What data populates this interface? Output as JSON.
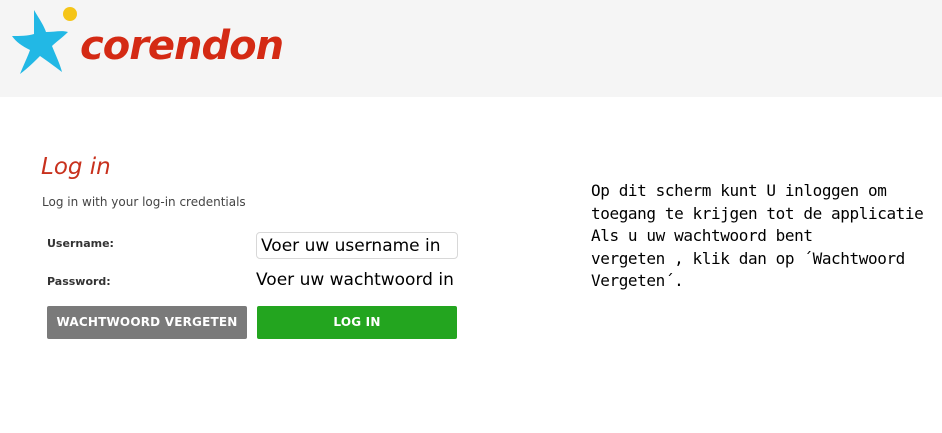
{
  "brand": {
    "name": "corendon",
    "colors": {
      "star": "#22b8e5",
      "dot": "#f5c518",
      "wordmark": "#d42a14"
    }
  },
  "login": {
    "title": "Log in",
    "subtitle": "Log in with your log-in credentials",
    "username_label": "Username:",
    "password_label": "Password:",
    "username_value": "Voer uw username in",
    "password_value": "Voer uw wachtwoord in",
    "forgot_button": "WACHTWOORD VERGETEN",
    "login_button": "LOG IN",
    "colors": {
      "title": "#c8311d",
      "forgot_button": "#7a7a7a",
      "login_button": "#23a51f"
    }
  },
  "help": {
    "lines": [
      "Op dit scherm kunt U inloggen om",
      "toegang te krijgen tot de applicatie",
      "Als u uw wachtwoord bent",
      "vergeten , klik dan op ´Wachtwoord",
      "Vergeten´."
    ]
  }
}
